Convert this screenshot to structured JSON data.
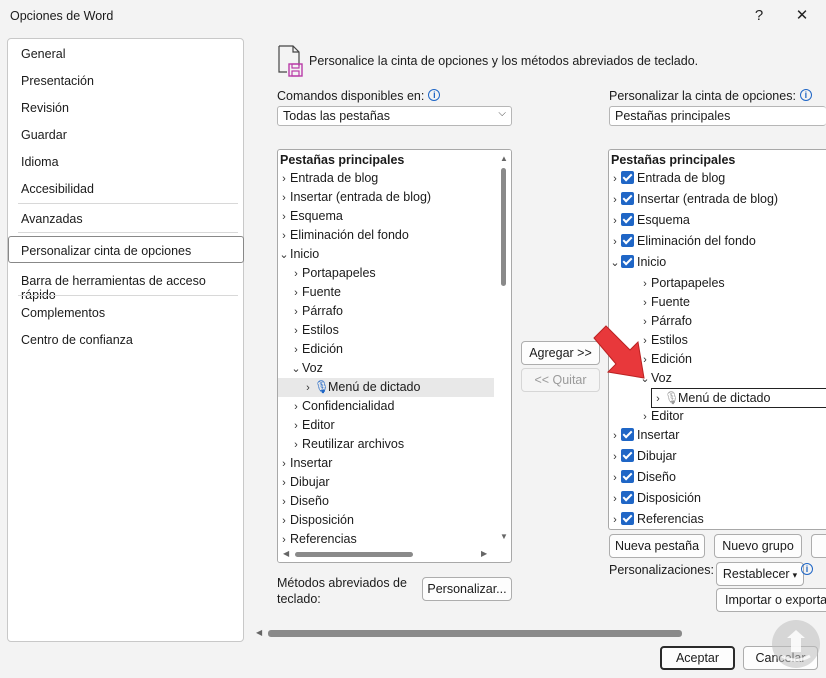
{
  "window": {
    "title": "Opciones de Word",
    "help_label": "?",
    "close_label": "✕"
  },
  "sidebar": {
    "items": [
      {
        "label": "General"
      },
      {
        "label": "Presentación"
      },
      {
        "label": "Revisión"
      },
      {
        "label": "Guardar"
      },
      {
        "label": "Idioma"
      },
      {
        "label": "Accesibilidad"
      },
      {
        "label": "Avanzadas"
      },
      {
        "label": "Personalizar cinta de opciones"
      },
      {
        "label": "Barra de herramientas de acceso rápido"
      },
      {
        "label": "Complementos"
      },
      {
        "label": "Centro de confianza"
      }
    ],
    "selected": "Personalizar cinta de opciones"
  },
  "header": {
    "text": "Personalice la cinta de opciones y los métodos abreviados de teclado."
  },
  "left": {
    "commands_label": "Comandos disponibles en:",
    "commands_value": "Todas las pestañas",
    "tree_header": "Pestañas principales",
    "tree": [
      {
        "label": "Entrada de blog"
      },
      {
        "label": "Insertar (entrada de blog)"
      },
      {
        "label": "Esquema"
      },
      {
        "label": "Eliminación del fondo"
      },
      {
        "label": "Inicio"
      },
      {
        "label": "Portapapeles"
      },
      {
        "label": "Fuente"
      },
      {
        "label": "Párrafo"
      },
      {
        "label": "Estilos"
      },
      {
        "label": "Edición"
      },
      {
        "label": "Voz"
      },
      {
        "label": "Menú de dictado"
      },
      {
        "label": "Confidencialidad"
      },
      {
        "label": "Editor"
      },
      {
        "label": "Reutilizar archivos"
      },
      {
        "label": "Insertar"
      },
      {
        "label": "Dibujar"
      },
      {
        "label": "Diseño"
      },
      {
        "label": "Disposición"
      },
      {
        "label": "Referencias"
      }
    ],
    "shortcuts_label": "Métodos abreviados de teclado:",
    "shortcuts_button": "Personalizar..."
  },
  "middle": {
    "add_button": "Agregar >>",
    "remove_button": "<< Quitar"
  },
  "right": {
    "ribbon_label": "Personalizar la cinta de opciones:",
    "ribbon_value": "Pestañas principales",
    "tree_header": "Pestañas principales",
    "tree": [
      {
        "label": "Entrada de blog",
        "checked": true
      },
      {
        "label": "Insertar (entrada de blog)",
        "checked": true
      },
      {
        "label": "Esquema",
        "checked": true
      },
      {
        "label": "Eliminación del fondo",
        "checked": true
      },
      {
        "label": "Inicio",
        "checked": true
      },
      {
        "label": "Portapapeles"
      },
      {
        "label": "Fuente"
      },
      {
        "label": "Párrafo"
      },
      {
        "label": "Estilos"
      },
      {
        "label": "Edición"
      },
      {
        "label": "Voz"
      },
      {
        "label": "Menú de dictado"
      },
      {
        "label": "Editor"
      },
      {
        "label": "Insertar",
        "checked": true
      },
      {
        "label": "Dibujar",
        "checked": true
      },
      {
        "label": "Diseño",
        "checked": true
      },
      {
        "label": "Disposición",
        "checked": true
      },
      {
        "label": "Referencias",
        "checked": true
      }
    ],
    "new_tab_button": "Nueva pestaña",
    "new_group_button": "Nuevo grupo",
    "customizations_label": "Personalizaciones:",
    "reset_button": "Restablecer",
    "import_export_button": "Importar o exportar"
  },
  "footer": {
    "ok_button": "Aceptar",
    "cancel_button": "Cancelar"
  },
  "colors": {
    "accent": "#1f66c6",
    "arrow": "#e8383b"
  }
}
